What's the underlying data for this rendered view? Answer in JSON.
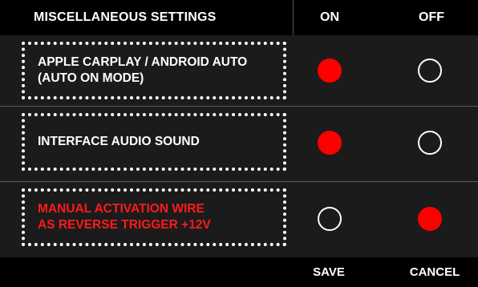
{
  "header": {
    "title": "MISCELLANEOUS SETTINGS",
    "on_label": "ON",
    "off_label": "OFF"
  },
  "settings": [
    {
      "label_line1": "APPLE CARPLAY / ANDROID AUTO",
      "label_line2": "(AUTO ON MODE)",
      "selected": "on",
      "label_color": "#ffffff"
    },
    {
      "label_line1": "INTERFACE AUDIO SOUND",
      "label_line2": "",
      "selected": "on",
      "label_color": "#ffffff"
    },
    {
      "label_line1": "MANUAL ACTIVATION WIRE",
      "label_line2": "AS REVERSE TRIGGER +12V",
      "selected": "off",
      "label_color": "#ff1a1a"
    }
  ],
  "footer": {
    "save_label": "SAVE",
    "cancel_label": "CANCEL"
  },
  "colors": {
    "selected": "#ff0000",
    "background": "#1b1b1b",
    "bar": "#000000"
  }
}
